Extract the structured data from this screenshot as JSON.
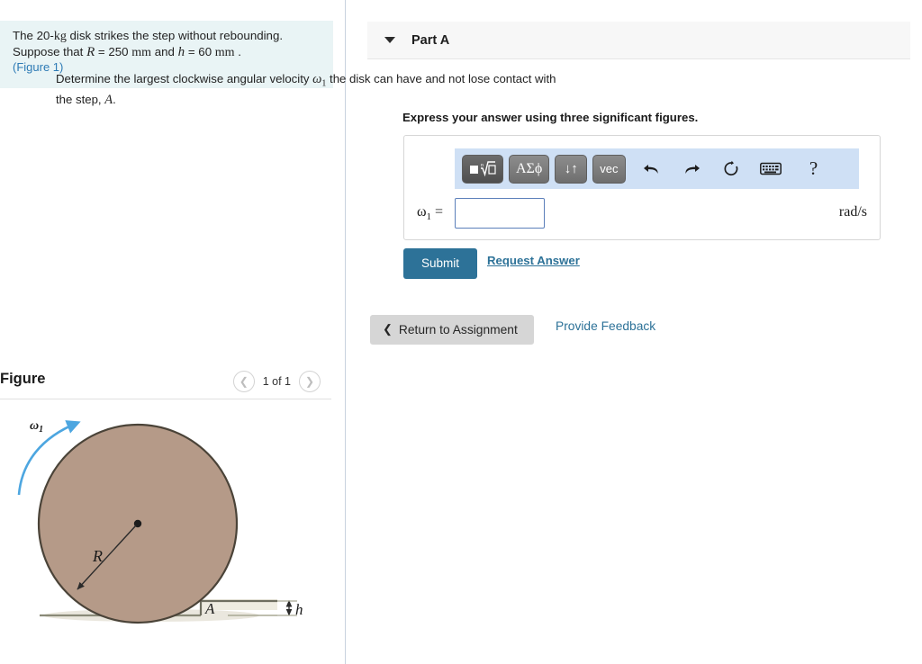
{
  "problem": {
    "line1_a": "The 20-",
    "line1_kg": "kg",
    "line1_b": " disk strikes the step without rebounding.",
    "line2_a": "Suppose that ",
    "line2_R": "R",
    "line2_b": " = 250 ",
    "line2_mm1": "mm",
    "line2_c": " and ",
    "line2_h": "h",
    "line2_d": " = 60 ",
    "line2_mm2": "mm",
    "line2_e": " .",
    "figure_link": "(Figure 1)"
  },
  "figure": {
    "title": "Figure",
    "pager_label": "1 of 1",
    "prev_icon": "chevron-left-icon",
    "next_icon": "chevron-right-icon",
    "labels": {
      "omega": "ω",
      "omega_sub": "1",
      "radius": "R",
      "step_point": "A",
      "height": "h"
    },
    "colors": {
      "disk_fill": "#b59a88",
      "disk_stroke": "#4a4338",
      "arrow": "#4da6e0",
      "ground": "#8a8a78"
    }
  },
  "part": {
    "caret_icon": "caret-down-icon",
    "title": "Part A",
    "question_a": "Determine the largest clockwise angular velocity ",
    "question_omega": "ω",
    "question_omega_sub": "1",
    "question_b": " the disk can have and not lose contact with the step, ",
    "question_A": "A",
    "question_c": ".",
    "express": "Express your answer using three significant figures."
  },
  "answer": {
    "toolbar": [
      {
        "name": "template-sqrt-button",
        "label": "■ⁿ√□",
        "active": true
      },
      {
        "name": "greek-symbols-button",
        "label": "ΑΣϕ",
        "active": false
      },
      {
        "name": "sub-superscript-button",
        "label": "↓↑",
        "active": false
      },
      {
        "name": "vector-button",
        "label": "vec",
        "active": false
      }
    ],
    "icons": [
      {
        "name": "undo-icon",
        "label": "undo"
      },
      {
        "name": "redo-icon",
        "label": "redo"
      },
      {
        "name": "reset-icon",
        "label": "reset"
      },
      {
        "name": "keyboard-icon",
        "label": "keyboard"
      },
      {
        "name": "help-icon",
        "label": "?"
      }
    ],
    "variable": "ω",
    "variable_sub": "1",
    "equals": "=",
    "input_value": "",
    "input_placeholder": "",
    "units": "rad/s",
    "submit_label": "Submit",
    "request_answer_label": "Request Answer"
  },
  "footer": {
    "return_chevron": "❮",
    "return_label": "Return to Assignment",
    "feedback_label": "Provide Feedback"
  },
  "colors": {
    "accent": "#2d7298",
    "problem_bg": "#e9f4f5",
    "toolbar_bg": "#cfe0f5",
    "header_bg": "#f7f7f7"
  }
}
